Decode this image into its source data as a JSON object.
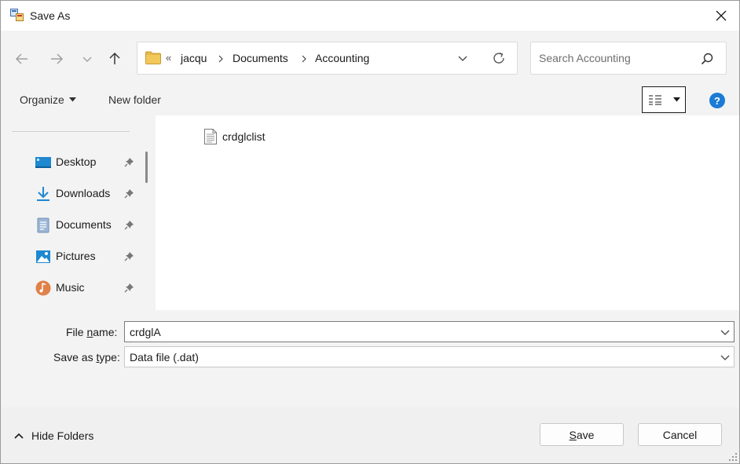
{
  "window": {
    "title": "Save As"
  },
  "nav": {
    "breadcrumb_overflow": "«",
    "breadcrumbs": [
      "jacqu",
      "Documents",
      "Accounting"
    ]
  },
  "search": {
    "placeholder": "Search Accounting"
  },
  "toolbar": {
    "organize_label": "Organize",
    "new_folder_label": "New folder",
    "help_label": "?"
  },
  "sidebar": {
    "items": [
      {
        "label": "Desktop",
        "icon": "desktop-icon"
      },
      {
        "label": "Downloads",
        "icon": "downloads-icon"
      },
      {
        "label": "Documents",
        "icon": "documents-icon"
      },
      {
        "label": "Pictures",
        "icon": "pictures-icon"
      },
      {
        "label": "Music",
        "icon": "music-icon"
      }
    ]
  },
  "files": [
    {
      "name": "crdglclist",
      "icon": "text-file-icon"
    }
  ],
  "form": {
    "file_name_label_pre": "File ",
    "file_name_label_ul": "n",
    "file_name_label_post": "ame:",
    "file_name_value": "crdglA",
    "type_label_pre": "Save as ",
    "type_label_ul": "t",
    "type_label_post": "ype:",
    "type_value": "Data file (.dat)"
  },
  "footer": {
    "hide_folders_label": "Hide Folders",
    "save_label_ul": "S",
    "save_label_rest": "ave",
    "cancel_label": "Cancel"
  },
  "colors": {
    "accent": "#1b7bd6",
    "folder": "#e8b84a",
    "panel": "#f3f3f3"
  }
}
